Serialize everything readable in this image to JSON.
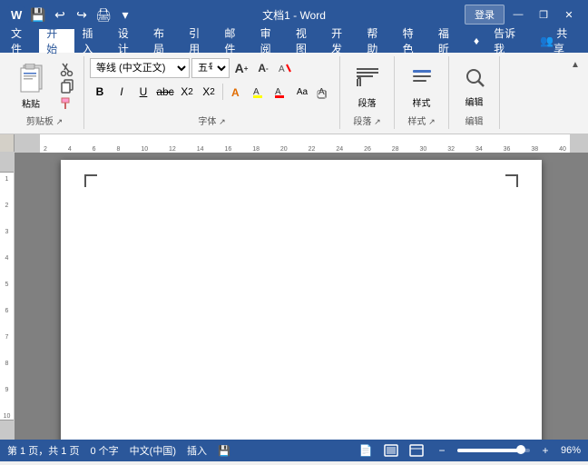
{
  "titlebar": {
    "title": "文档1 - Word",
    "login": "登录",
    "quick_access": [
      "save",
      "undo",
      "redo",
      "customize"
    ],
    "window_buttons": [
      "minimize",
      "restore",
      "close"
    ]
  },
  "menubar": {
    "items": [
      "文件",
      "开始",
      "插入",
      "设计",
      "布局",
      "引用",
      "邮件",
      "审阅",
      "视图",
      "开发",
      "帮助",
      "特色",
      "福昕",
      "♦",
      "告诉我",
      "共享"
    ],
    "active": "开始"
  },
  "ribbon": {
    "groups": [
      {
        "name": "剪贴板",
        "buttons": [
          "粘贴"
        ]
      },
      {
        "name": "字体",
        "font_name": "等线 (中文正文)",
        "font_size": "五号",
        "buttons": [
          "B",
          "I",
          "U",
          "abc",
          "X₂",
          "X²",
          "A",
          "A",
          "Aa",
          "A",
          "A",
          "A"
        ]
      },
      {
        "name": "段落"
      },
      {
        "name": "样式"
      },
      {
        "name": "编辑"
      }
    ]
  },
  "ruler": {
    "marks": [
      2,
      4,
      6,
      8,
      10,
      12,
      14,
      16,
      18,
      20,
      22,
      24,
      26,
      28,
      30,
      32,
      34,
      36,
      38,
      40
    ]
  },
  "statusbar": {
    "page_info": "第 1 页，共 1 页",
    "word_count": "0 个字",
    "language": "中文(中国)",
    "input_mode": "插入",
    "zoom_level": "96%",
    "zoom_value": 96
  }
}
